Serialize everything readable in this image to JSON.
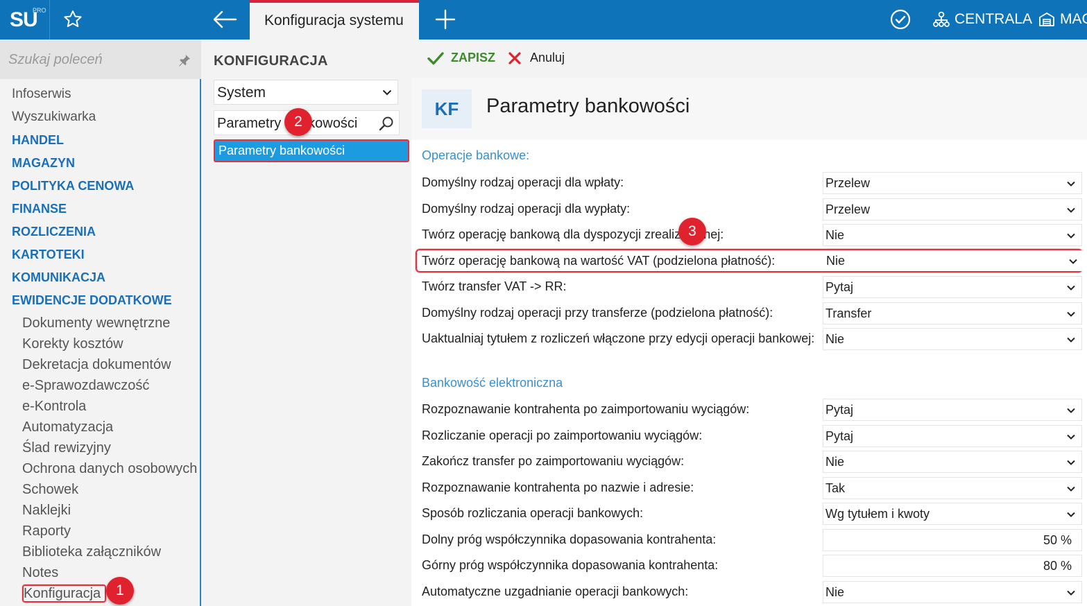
{
  "topbar": {
    "logo": "SU",
    "logo_badge": "PRO",
    "active_tab": "Konfiguracja systemu",
    "centrala_label": "CENTRALA",
    "magazyn_label": "MAG",
    "icons": [
      "star-icon",
      "back-arrow-icon",
      "plus-icon",
      "check-circle-icon",
      "org-tree-icon",
      "warehouse-icon"
    ]
  },
  "sidebar": {
    "search_placeholder": "Szukaj poleceń",
    "items": [
      {
        "label": "Infoserwis",
        "type": "link"
      },
      {
        "label": "Wyszukiwarka",
        "type": "link"
      },
      {
        "label": "HANDEL",
        "type": "section"
      },
      {
        "label": "MAGAZYN",
        "type": "section"
      },
      {
        "label": "POLITYKA CENOWA",
        "type": "section"
      },
      {
        "label": "FINANSE",
        "type": "section"
      },
      {
        "label": "ROZLICZENIA",
        "type": "section"
      },
      {
        "label": "KARTOTEKI",
        "type": "section"
      },
      {
        "label": "KOMUNIKACJA",
        "type": "section"
      },
      {
        "label": "EWIDENCJE DODATKOWE",
        "type": "section"
      }
    ],
    "sub_items": [
      "Dokumenty wewnętrzne",
      "Korekty kosztów",
      "Dekretacja dokumentów",
      "e-Sprawozdawczość",
      "e-Kontrola",
      "Automatyzacja",
      "Ślad rewizyjny",
      "Ochrona danych osobowych",
      "Schowek",
      "Naklejki",
      "Raporty",
      "Biblioteka załączników",
      "Notes",
      "Konfiguracja"
    ]
  },
  "middle": {
    "title": "KONFIGURACJA",
    "category": "System",
    "search_value": "Parametry bankowości",
    "result": "Parametry bankowości"
  },
  "toolbar": {
    "save_label": "ZAPISZ",
    "cancel_label": "Anuluj"
  },
  "header": {
    "code": "KF",
    "title": "Parametry bankowości"
  },
  "sections": {
    "bank_ops": {
      "title": "Operacje bankowe:",
      "rows": [
        {
          "label": "Domyślny rodzaj operacji dla wpłaty:",
          "value": "Przelew"
        },
        {
          "label": "Domyślny rodzaj operacji dla wypłaty:",
          "value": "Przelew"
        },
        {
          "label": "Twórz operację bankową dla dyspozycji zrealizowanej:",
          "value": "Nie"
        },
        {
          "label": "Twórz operację bankową na wartość VAT (podzielona płatność):",
          "value": "Nie"
        },
        {
          "label": "Twórz transfer VAT -> RR:",
          "value": "Pytaj"
        },
        {
          "label": "Domyślny rodzaj operacji przy transferze (podzielona płatność):",
          "value": "Transfer"
        },
        {
          "label": "Uaktualniaj tytułem z rozliczeń włączone przy edycji operacji bankowej:",
          "value": "Nie"
        }
      ]
    },
    "e_banking": {
      "title": "Bankowość elektroniczna",
      "rows": [
        {
          "label": "Rozpoznawanie kontrahenta po zaimportowaniu wyciągów:",
          "value": "Pytaj"
        },
        {
          "label": "Rozliczanie operacji po zaimportowaniu wyciągów:",
          "value": "Pytaj"
        },
        {
          "label": "Zakończ transfer po zaimportowaniu wyciągów:",
          "value": "Nie"
        },
        {
          "label": "Rozpoznawanie kontrahenta po nazwie i adresie:",
          "value": "Tak"
        },
        {
          "label": "Sposób rozliczania operacji bankowych:",
          "value": "Wg tytułem i kwoty"
        },
        {
          "label": "Dolny próg współczynnika dopasowania kontrahenta:",
          "value": "50 %"
        },
        {
          "label": "Górny próg współczynnika dopasowania kontrahenta:",
          "value": "80 %"
        },
        {
          "label": "Automatyczne uzgadnianie operacji bankowych:",
          "value": "Nie"
        }
      ]
    }
  },
  "badges": [
    "1",
    "2",
    "3"
  ],
  "colors": {
    "topbar": "#0e73b9",
    "accent": "#1a6fb8",
    "selection": "#1d9be0",
    "highlight": "#e0333f",
    "save": "#3d8b2c"
  }
}
